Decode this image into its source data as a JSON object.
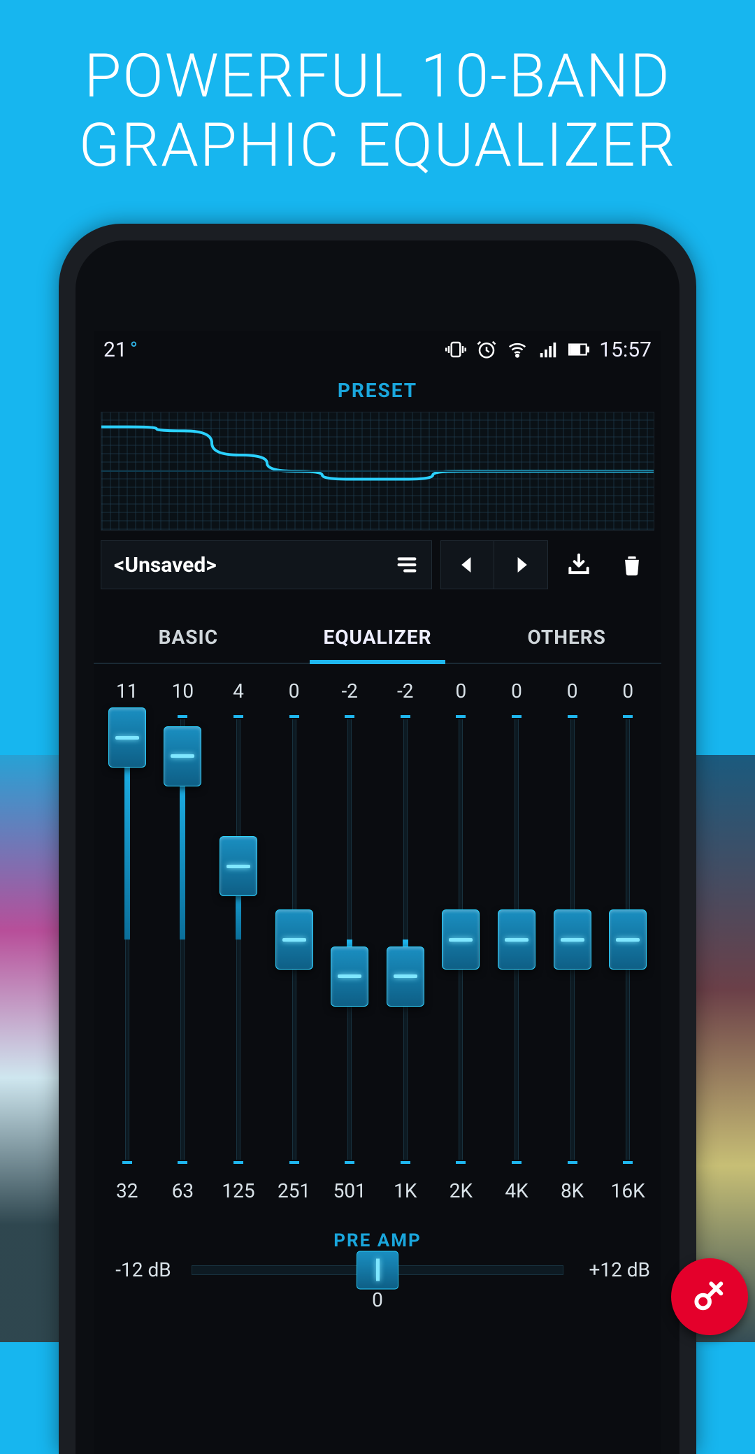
{
  "promo": {
    "line1": "POWERFUL 10-BAND",
    "line2": "GRAPHIC EQUALIZER"
  },
  "status": {
    "temp": "21",
    "time": "15:57"
  },
  "preset": {
    "section_label": "PRESET",
    "name": "<Unsaved>"
  },
  "tabs": {
    "basic": "BASIC",
    "equalizer": "EQUALIZER",
    "others": "OTHERS",
    "active": "equalizer"
  },
  "eq": {
    "min": -12,
    "max": 12,
    "bands": [
      {
        "freq": "32",
        "value": 11
      },
      {
        "freq": "63",
        "value": 10
      },
      {
        "freq": "125",
        "value": 4
      },
      {
        "freq": "251",
        "value": 0
      },
      {
        "freq": "501",
        "value": -2
      },
      {
        "freq": "1K",
        "value": -2
      },
      {
        "freq": "2K",
        "value": 0
      },
      {
        "freq": "4K",
        "value": 0
      },
      {
        "freq": "8K",
        "value": 0
      },
      {
        "freq": "16K",
        "value": 0
      }
    ]
  },
  "preamp": {
    "label": "PRE AMP",
    "min_label": "-12 dB",
    "max_label": "+12 dB",
    "value": 0
  },
  "colors": {
    "accent": "#1fb7ef",
    "bg": "#17b6ef"
  }
}
